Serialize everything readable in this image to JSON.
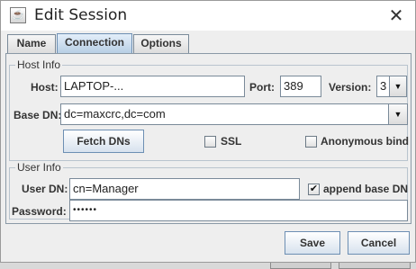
{
  "window": {
    "title": "Edit Session",
    "close_symbol": "✕"
  },
  "tabs": [
    {
      "label": "Name",
      "active": false
    },
    {
      "label": "Connection",
      "active": true
    },
    {
      "label": "Options",
      "active": false
    }
  ],
  "host_info": {
    "group_title": "Host Info",
    "host_label": "Host:",
    "host_value": "LAPTOP-...",
    "port_label": "Port:",
    "port_value": "389",
    "version_label": "Version:",
    "version_value": "3",
    "base_dn_label": "Base DN:",
    "base_dn_value": "dc=maxcrc,dc=com",
    "fetch_dns_label": "Fetch DNs",
    "ssl_label": "SSL",
    "ssl_checked": false,
    "anonymous_bind_label": "Anonymous bind",
    "anonymous_bind_checked": false
  },
  "user_info": {
    "group_title": "User Info",
    "user_dn_label": "User DN:",
    "user_dn_value": "cn=Manager",
    "append_base_dn_label": "append base DN",
    "append_base_dn_checked": true,
    "append_check_mark": "✔",
    "password_label": "Password:",
    "password_value": "••••••"
  },
  "buttons": {
    "save_label": "Save",
    "cancel_label": "Cancel"
  },
  "icons": {
    "app_icon": "java-app-icon",
    "combo_arrow": "▼"
  }
}
